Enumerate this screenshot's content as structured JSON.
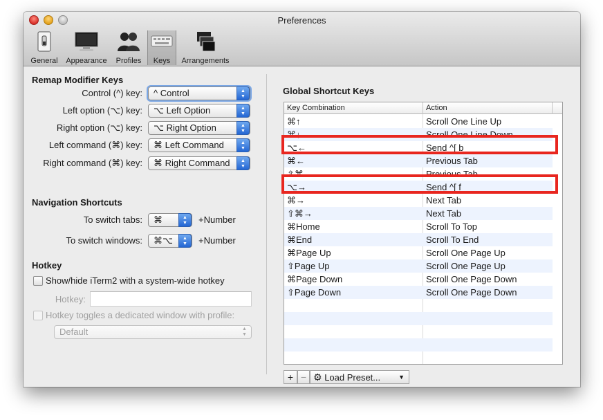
{
  "window": {
    "title": "Preferences"
  },
  "toolbar": {
    "items": [
      {
        "label": "General",
        "icon": "switch-icon",
        "selected": false
      },
      {
        "label": "Appearance",
        "icon": "display-icon",
        "selected": false
      },
      {
        "label": "Profiles",
        "icon": "users-icon",
        "selected": false
      },
      {
        "label": "Keys",
        "icon": "keyboard-icon",
        "selected": true
      },
      {
        "label": "Arrangements",
        "icon": "windows-icon",
        "selected": false
      }
    ]
  },
  "remap": {
    "title": "Remap Modifier Keys",
    "rows": [
      {
        "label": "Control (^) key:",
        "value": "^ Control"
      },
      {
        "label": "Left option (⌥) key:",
        "value": "⌥ Left Option"
      },
      {
        "label": "Right option (⌥) key:",
        "value": "⌥ Right Option"
      },
      {
        "label": "Left command (⌘) key:",
        "value": "⌘ Left Command"
      },
      {
        "label": "Right command (⌘) key:",
        "value": "⌘ Right Command"
      }
    ]
  },
  "navigation": {
    "title": "Navigation Shortcuts",
    "tabs_label": "To switch tabs:",
    "tabs_value": "⌘",
    "tabs_suffix": "+Number",
    "windows_label": "To switch windows:",
    "windows_value": "⌘⌥",
    "windows_suffix": "+Number"
  },
  "hotkey": {
    "title": "Hotkey",
    "toggle_label": "Show/hide iTerm2 with a system-wide hotkey",
    "hotkey_label": "Hotkey:",
    "hotkey_value": "",
    "dedicated_label": "Hotkey toggles a dedicated window with profile:",
    "profile_value": "Default"
  },
  "global": {
    "title": "Global Shortcut Keys",
    "columns": [
      "Key Combination",
      "Action"
    ],
    "rows": [
      {
        "key": "⌘↑",
        "action": "Scroll One Line Up"
      },
      {
        "key": "⌘↓",
        "action": "Scroll One Line Down"
      },
      {
        "key": "⌥←",
        "action": "Send ^[ b"
      },
      {
        "key": "⌘←",
        "action": "Previous Tab"
      },
      {
        "key": "⇧⌘←",
        "action": "Previous Tab"
      },
      {
        "key": "⌥→",
        "action": "Send ^[ f"
      },
      {
        "key": "⌘→",
        "action": "Next Tab"
      },
      {
        "key": "⇧⌘→",
        "action": "Next Tab"
      },
      {
        "key": "⌘Home",
        "action": "Scroll To Top"
      },
      {
        "key": "⌘End",
        "action": "Scroll To End"
      },
      {
        "key": "⌘Page Up",
        "action": "Scroll One Page Up"
      },
      {
        "key": "⇧Page Up",
        "action": "Scroll One Page Up"
      },
      {
        "key": "⌘Page Down",
        "action": "Scroll One Page Down"
      },
      {
        "key": "⇧Page Down",
        "action": "Scroll One Page Down"
      }
    ],
    "add_label": "+",
    "remove_label": "−",
    "preset_label": "Load Preset...",
    "preset_icon": "gear-icon"
  },
  "colors": {
    "highlight": "#e8261f",
    "accent": "#2466d3",
    "row_alt": "#edf3fe"
  }
}
